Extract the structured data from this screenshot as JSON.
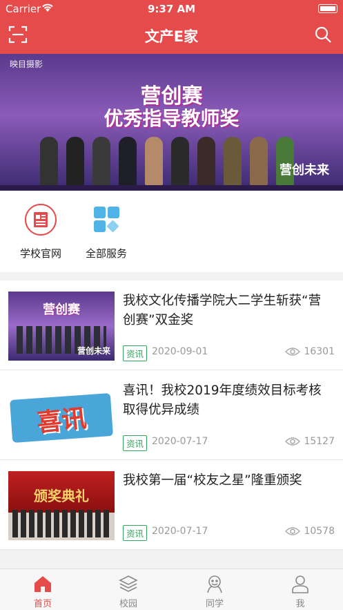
{
  "status_bar": {
    "carrier": "Carrier",
    "time": "9:37 AM"
  },
  "nav": {
    "title": "文产E家"
  },
  "banner": {
    "logo_text": "映目摄影",
    "headline1": "营创赛",
    "headline2": "优秀指导教师奖",
    "corner_text": "营创未来"
  },
  "services": [
    {
      "label": "学校官网"
    },
    {
      "label": "全部服务"
    }
  ],
  "news": [
    {
      "title": "我校文化传播学院大二学生斩获“营创赛”双金奖",
      "tag": "资讯",
      "date": "2020-09-01",
      "views": "16301",
      "thumb_headline": "营创赛",
      "thumb_sub": "营创未来"
    },
    {
      "title": "喜讯！我校2019年度绩效目标考核取得优异成绩",
      "tag": "资讯",
      "date": "2020-07-17",
      "views": "15127",
      "thumb_headline": "喜讯"
    },
    {
      "title": "我校第一届“校友之星”隆重颁奖",
      "tag": "资讯",
      "date": "2020-07-17",
      "views": "10578",
      "thumb_headline": "颁奖典礼"
    }
  ],
  "tabs": [
    {
      "label": "首页"
    },
    {
      "label": "校园"
    },
    {
      "label": "同学"
    },
    {
      "label": "我"
    }
  ],
  "colors": {
    "accent": "#e64b4b",
    "tag_green": "#35a35a",
    "icon_blue": "#4fb3e8"
  }
}
